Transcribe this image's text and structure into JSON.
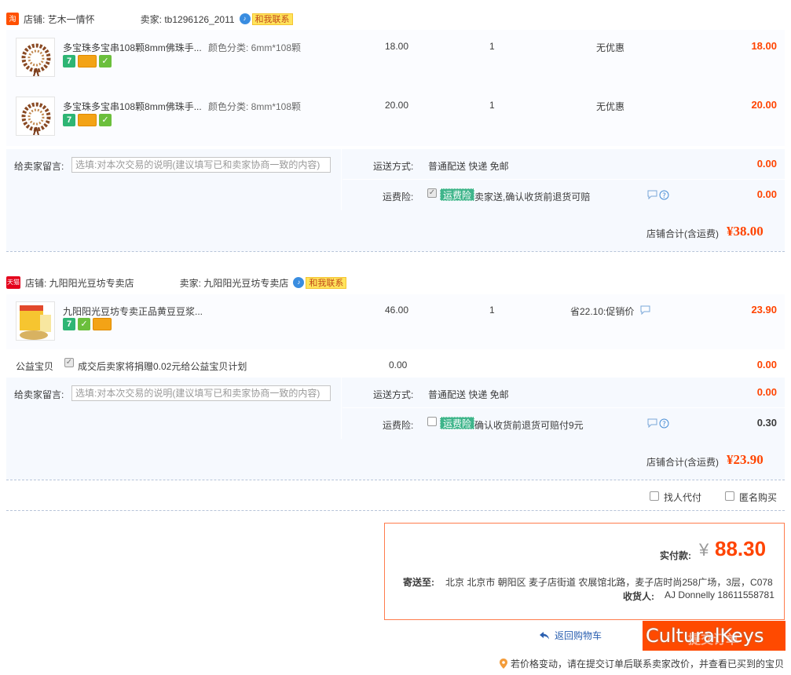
{
  "shop1": {
    "badge": "淘",
    "label": "店铺: 艺木一情怀",
    "seller": "卖家: tb1296126_2011",
    "contact": "和我联系",
    "items": [
      {
        "title": "多宝珠多宝串108颗8mm佛珠手...",
        "sku": "颜色分类: 6mm*108颗",
        "price": "18.00",
        "qty": "1",
        "discount": "无优惠",
        "subtotal": "18.00"
      },
      {
        "title": "多宝珠多宝串108颗8mm佛珠手...",
        "sku": "颜色分类: 8mm*108颗",
        "price": "20.00",
        "qty": "1",
        "discount": "无优惠",
        "subtotal": "20.00"
      }
    ],
    "note_label": "给卖家留言:",
    "note_placeholder": "选填:对本次交易的说明(建议填写已和卖家协商一致的内容)",
    "ship_label": "运送方式:",
    "ship_value": "普通配送 快递 免邮",
    "ship_fee": "0.00",
    "ins_label": "运费险:",
    "ins_tag": "运费险",
    "ins_text": "卖家送,确认收货前退货可赔",
    "ins_fee": "0.00",
    "total_label": "店铺合计(含运费)",
    "total": "¥38.00"
  },
  "shop2": {
    "badge": "天猫",
    "label": "店铺: 九阳阳光豆坊专卖店",
    "seller": "卖家: 九阳阳光豆坊专卖店",
    "contact": "和我联系",
    "item": {
      "title": "九阳阳光豆坊专卖正品黄豆豆浆...",
      "price": "46.00",
      "qty": "1",
      "discount": "省22.10:促销价",
      "subtotal": "23.90"
    },
    "charity_label": "公益宝贝",
    "charity_text": "成交后卖家将捐赠0.02元给公益宝贝计划",
    "charity_price": "0.00",
    "charity_subtotal": "0.00",
    "note_label": "给卖家留言:",
    "note_placeholder": "选填:对本次交易的说明(建议填写已和卖家协商一致的内容)",
    "ship_label": "运送方式:",
    "ship_value": "普通配送 快递 免邮",
    "ship_fee": "0.00",
    "ins_label": "运费险:",
    "ins_tag": "运费险",
    "ins_text": "确认收货前退货可赔付9元",
    "ins_fee": "0.30",
    "total_label": "店铺合计(含运费)",
    "total": "¥23.90"
  },
  "options": {
    "proxy": "找人代付",
    "anonymous": "匿名购买"
  },
  "payment": {
    "label": "实付款:",
    "currency": "¥",
    "amount": "88.30",
    "addr_label": "寄送至:",
    "addr": "北京 北京市 朝阳区 麦子店街道 农展馆北路，麦子店时尚258广场，3层，C078",
    "receiver_label": "收货人:",
    "receiver": "AJ Donnelly 18611558781"
  },
  "footer": {
    "back": "返回购物车",
    "submit": "提交订单",
    "watermark": "CulturalKeys",
    "hint": "若价格变动，请在提交订单后联系卖家改价，并查看已买到的宝贝"
  },
  "colors": {
    "accent": "#ff4400",
    "row_bg": "#f6f9fe",
    "ins_tag": "#3fb58b"
  }
}
